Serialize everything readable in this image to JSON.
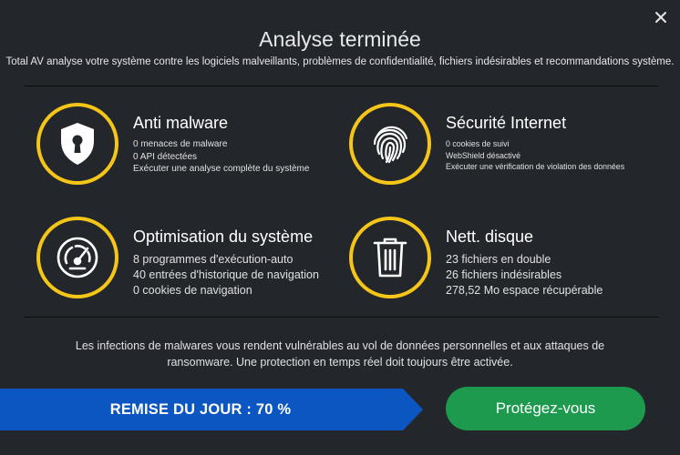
{
  "header": {
    "title": "Analyse terminée",
    "subtitle": "Total AV analyse votre système contre les logiciels malveillants, problèmes de confidentialité, fichiers indésirables et recommandations système."
  },
  "cards": {
    "malware": {
      "title": "Anti malware",
      "lines": [
        "0 menaces de malware",
        "0 API détectées",
        "Exécuter une analyse complète du système"
      ],
      "icon": "shield-lock-icon"
    },
    "internet": {
      "title": "Sécurité Internet",
      "lines": [
        "0 cookies de suivi",
        "WebShield désactivé",
        "Exécuter une vérification de violation des données"
      ],
      "icon": "fingerprint-icon"
    },
    "optimization": {
      "title": "Optimisation du système",
      "lines": [
        "8 programmes d'exécution-auto",
        "40 entrées d'historique de navigation",
        "0 cookies de navigation"
      ],
      "icon": "speedometer-icon"
    },
    "disk": {
      "title": "Nett. disque",
      "lines": [
        "23 fichiers en double",
        "26 fichiers indésirables",
        "278,52 Mo espace récupérable"
      ],
      "icon": "trash-icon"
    }
  },
  "info_text": "Les infections de malwares vous rendent vulnérables au vol de données personnelles et aux attaques de ransomware. Une protection en temps réel doit toujours être activée.",
  "promo": {
    "label": "REMISE DU JOUR : 70 %"
  },
  "cta": {
    "label": "Protégez-vous"
  },
  "colors": {
    "background": "#23272c",
    "accent_ring": "#f5c518",
    "promo_blue": "#0b56c0",
    "cta_green": "#1d9a4e"
  }
}
